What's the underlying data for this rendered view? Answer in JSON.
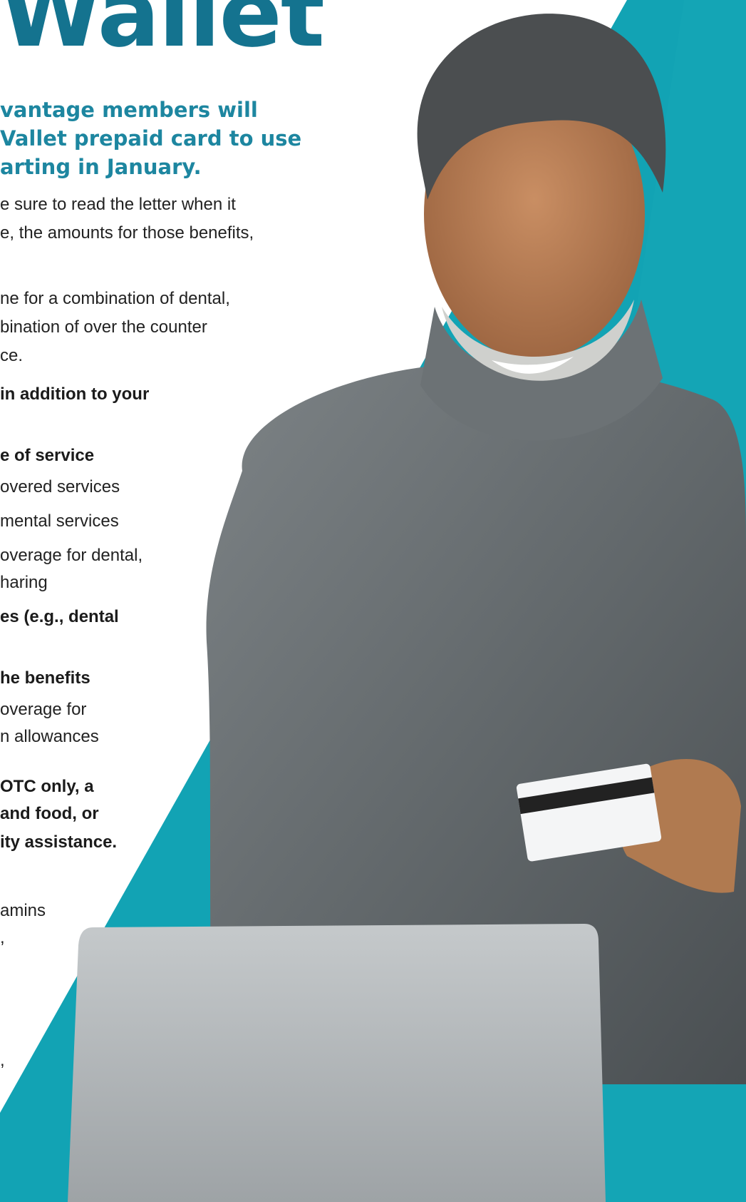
{
  "headline": "Wallet",
  "subhead": [
    "vantage members will",
    "Vallet prepaid card to use",
    "arting in January."
  ],
  "paragraphs": [
    [
      "e sure to read the letter when it",
      "e, the amounts for those benefits,"
    ],
    [
      "ne for a combination of dental,",
      "bination of over the counter",
      "ce."
    ]
  ],
  "bold_intro": "in addition to your",
  "sections": [
    {
      "heading": "e of service",
      "lines": [
        "overed services",
        "mental services",
        "overage for dental,",
        "haring"
      ]
    },
    {
      "heading_lines": [
        "es (e.g., dental"
      ]
    },
    {
      "heading": "he benefits",
      "lines": [
        "overage for",
        "n allowances"
      ]
    },
    {
      "heading_lines": [
        "OTC only, a",
        "and food, or",
        "ity assistance."
      ]
    }
  ],
  "tail_lines": [
    "amins",
    ",",
    ","
  ],
  "colors": {
    "headline": "#14738f",
    "subhead": "#1d86a0",
    "teal_band": "#12a3b4",
    "body_text": "#222222"
  },
  "image": {
    "description_icon": "man-with-credit-card-photo"
  }
}
